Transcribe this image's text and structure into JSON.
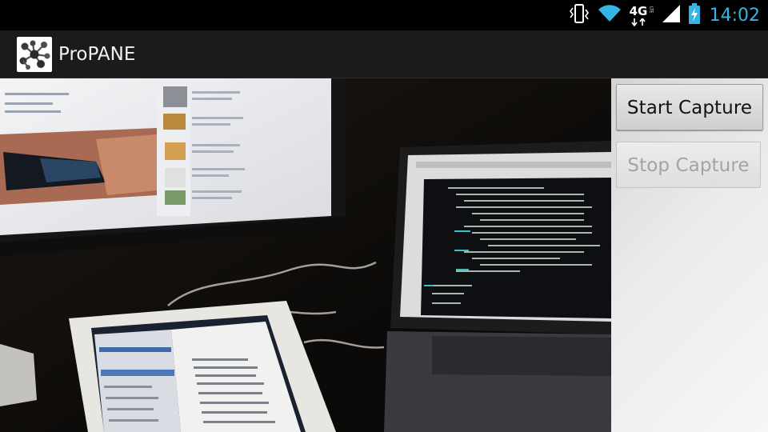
{
  "status_bar": {
    "clock": "14:02",
    "network_label": "4G",
    "network_sub": "LTE",
    "icons": [
      "vibrate-icon",
      "wifi-icon",
      "signal-icon",
      "battery-charging-icon"
    ],
    "accent_color": "#33b5e5"
  },
  "action_bar": {
    "title": "ProPANE",
    "icon": "molecule-icon"
  },
  "panel": {
    "start_label": "Start Capture",
    "stop_label": "Stop Capture",
    "stop_enabled": false
  }
}
